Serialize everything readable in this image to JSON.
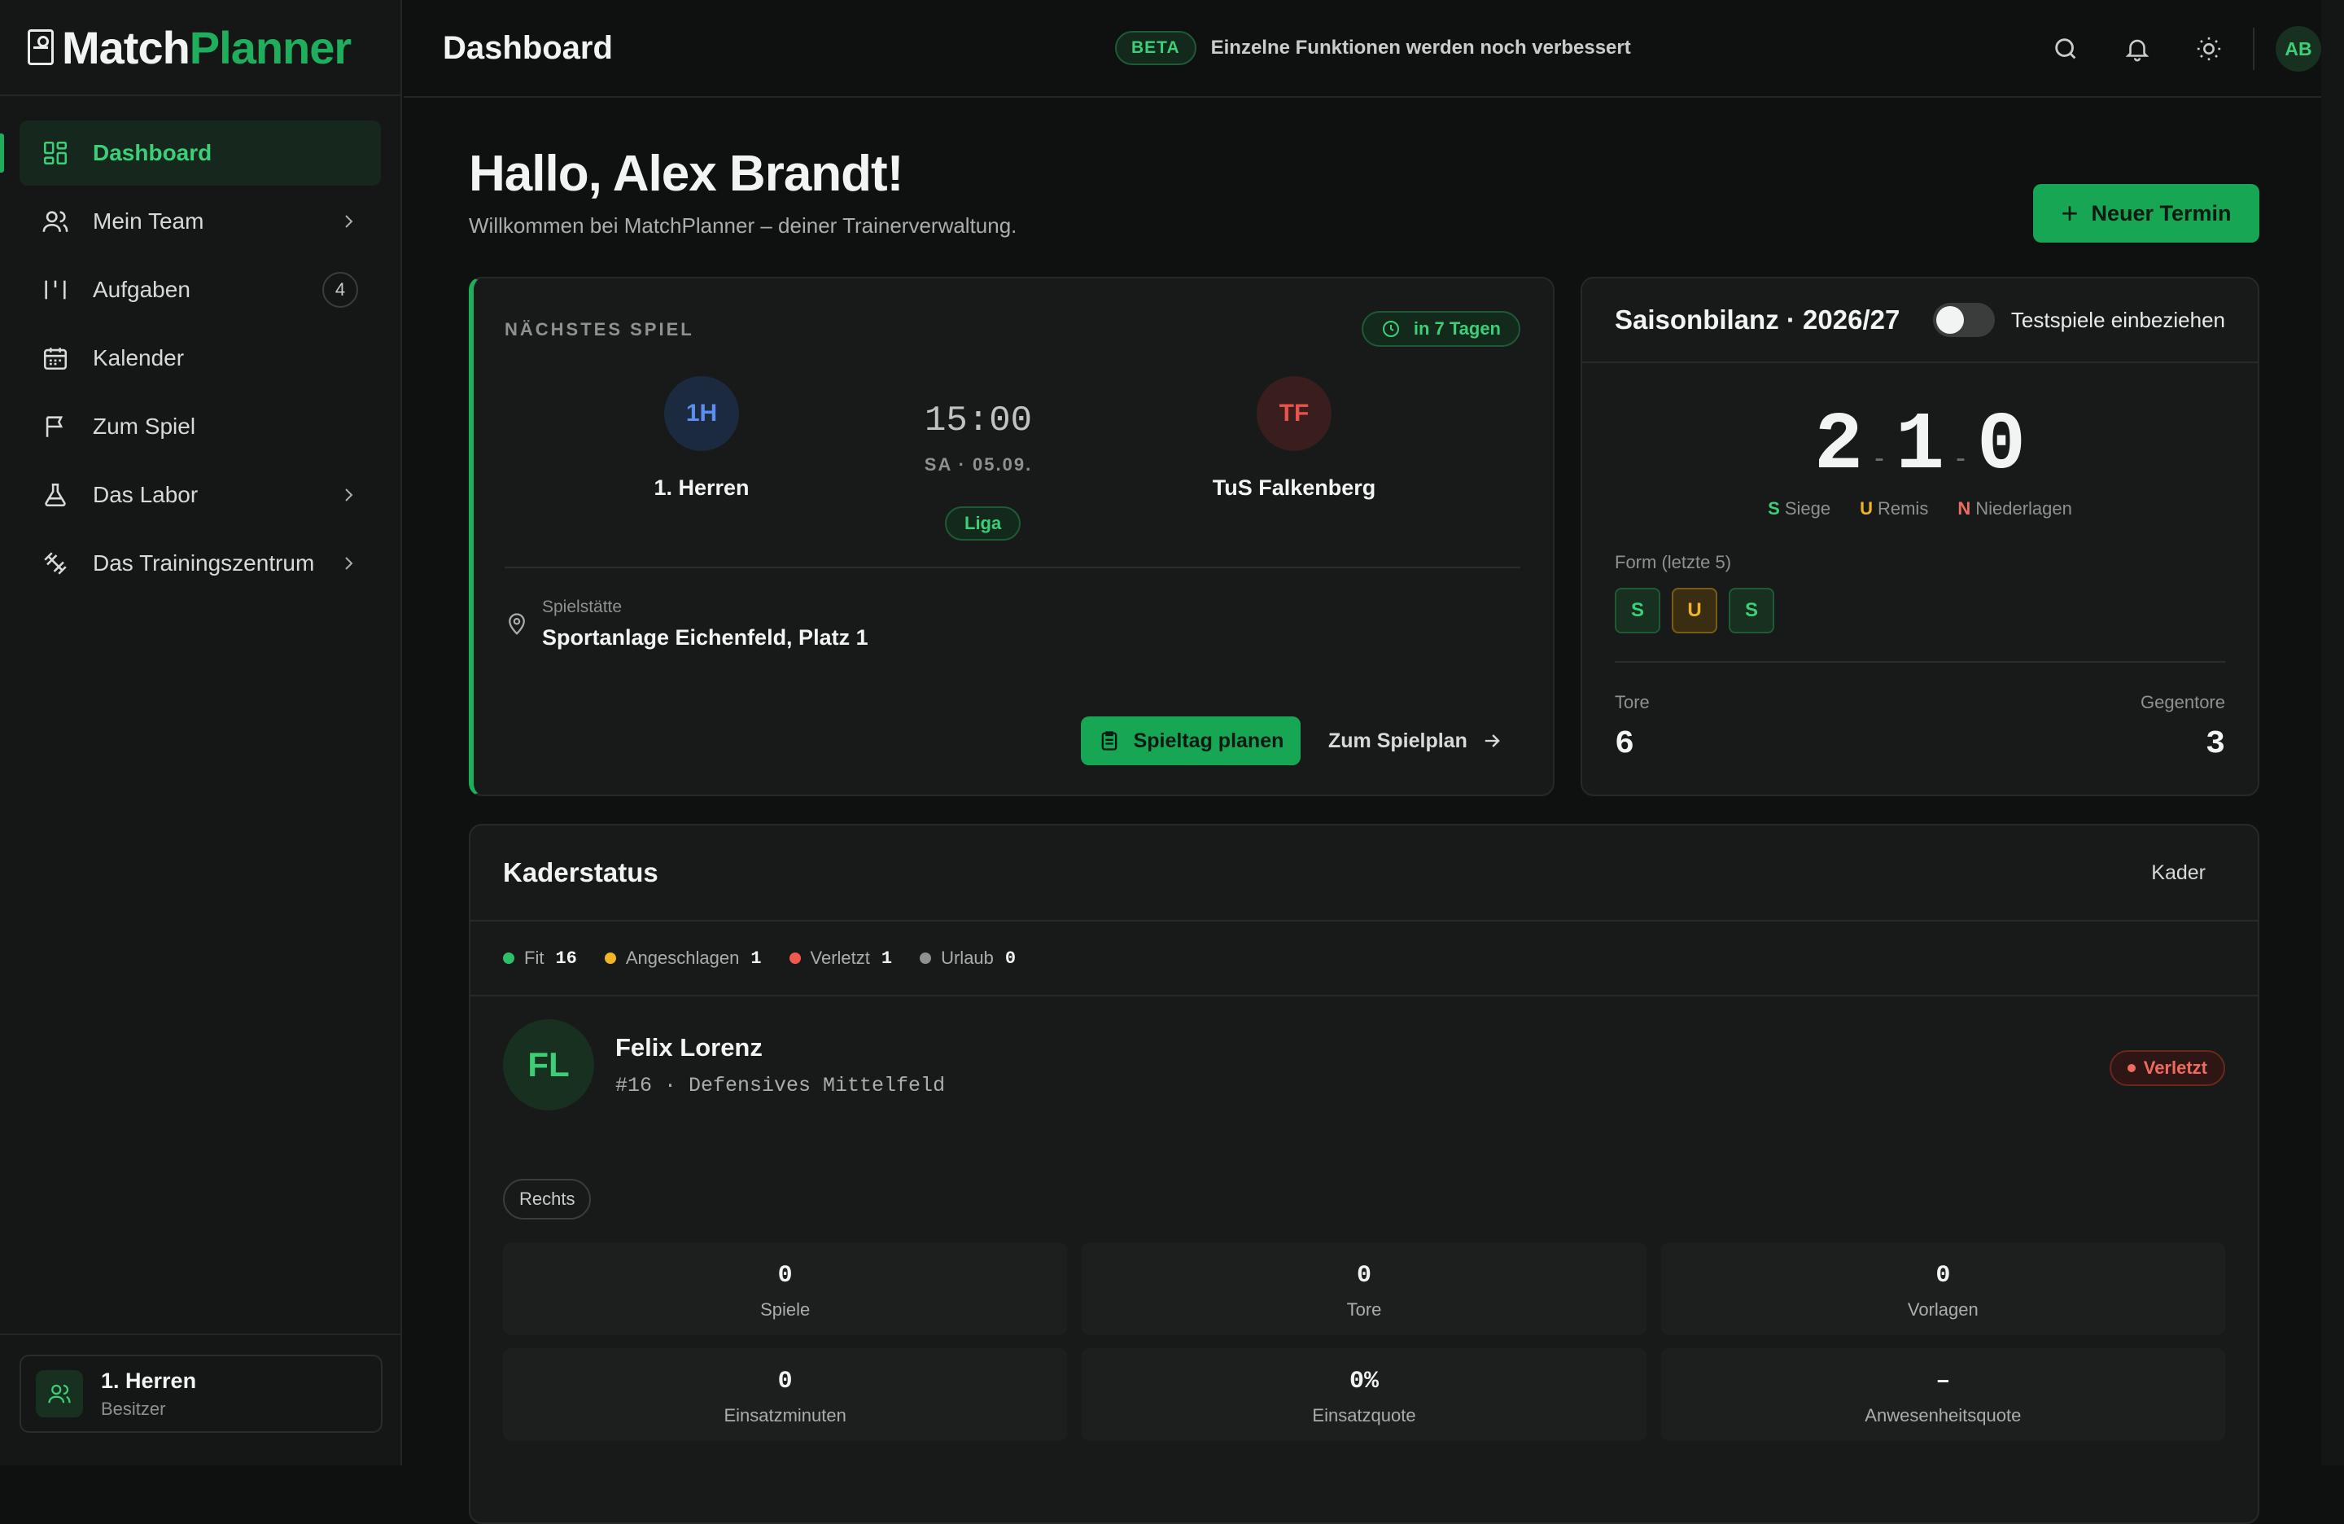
{
  "app": {
    "logo_part1": "Match",
    "logo_part2": "Planner"
  },
  "sidebar": {
    "items": [
      {
        "label": "Dashboard",
        "icon": "dashboard-icon"
      },
      {
        "label": "Mein Team",
        "icon": "users-icon"
      },
      {
        "label": "Aufgaben",
        "icon": "tasks-icon",
        "badge": "4"
      },
      {
        "label": "Kalender",
        "icon": "calendar-icon"
      },
      {
        "label": "Zum Spiel",
        "icon": "flag-icon"
      },
      {
        "label": "Das Labor",
        "icon": "flask-icon"
      },
      {
        "label": "Das Trainingszentrum",
        "icon": "dumbbell-icon"
      }
    ],
    "team": {
      "name": "1. Herren",
      "role": "Besitzer"
    }
  },
  "topbar": {
    "title": "Dashboard",
    "beta_label": "BETA",
    "beta_text": "Einzelne Funktionen werden noch verbessert",
    "avatar": "AB"
  },
  "main": {
    "greeting": "Hallo, Alex Brandt!",
    "welcome": "Willkommen bei MatchPlanner – deiner Trainerverwaltung.",
    "new_button": "Neuer Termin"
  },
  "next_match": {
    "label": "NÄCHSTES SPIEL",
    "countdown": "in 7 Tagen",
    "home": {
      "short": "1H",
      "name": "1. Herren"
    },
    "away": {
      "short": "TF",
      "name": "TuS Falkenberg"
    },
    "time": "15:00",
    "date": "SA · 05.09.",
    "competition": "Liga",
    "venue_label": "Spielstätte",
    "venue": "Sportanlage Eichenfeld, Platz 1",
    "plan_button": "Spieltag planen",
    "schedule_link": "Zum Spielplan"
  },
  "season": {
    "title": "Saisonbilanz · 2026/27",
    "toggle_label": "Testspiele einbeziehen",
    "wins": "2",
    "draws": "1",
    "losses": "0",
    "sep": "-",
    "legend": {
      "w_key": "S",
      "w": "Siege",
      "d_key": "U",
      "d": "Remis",
      "l_key": "N",
      "l": "Niederlagen"
    },
    "form_label": "Form (letzte 5)",
    "form": [
      "S",
      "U",
      "S"
    ],
    "goals_label": "Tore",
    "goals": "6",
    "against_label": "Gegentore",
    "against": "3",
    "colors": {
      "win": "#3ccf77",
      "draw": "#f0b429",
      "loss": "#ef6b60"
    }
  },
  "squad": {
    "title": "Kaderstatus",
    "link": "Kader",
    "status": [
      {
        "label": "Fit",
        "count": "16",
        "color": "#2fbf68"
      },
      {
        "label": "Angeschlagen",
        "count": "1",
        "color": "#f0b429"
      },
      {
        "label": "Verletzt",
        "count": "1",
        "color": "#ef5a4f"
      },
      {
        "label": "Urlaub",
        "count": "0",
        "color": "#8d918f"
      }
    ],
    "player": {
      "initials": "FL",
      "name": "Felix Lorenz",
      "meta": "#16 · Defensives Mittelfeld",
      "status": "Verletzt",
      "foot": "Rechts",
      "stats": [
        {
          "value": "0",
          "label": "Spiele"
        },
        {
          "value": "0",
          "label": "Tore"
        },
        {
          "value": "0",
          "label": "Vorlagen"
        },
        {
          "value": "0",
          "label": "Einsatzminuten"
        },
        {
          "value": "0%",
          "label": "Einsatzquote"
        },
        {
          "value": "–",
          "label": "Anwesenheitsquote"
        }
      ]
    }
  }
}
